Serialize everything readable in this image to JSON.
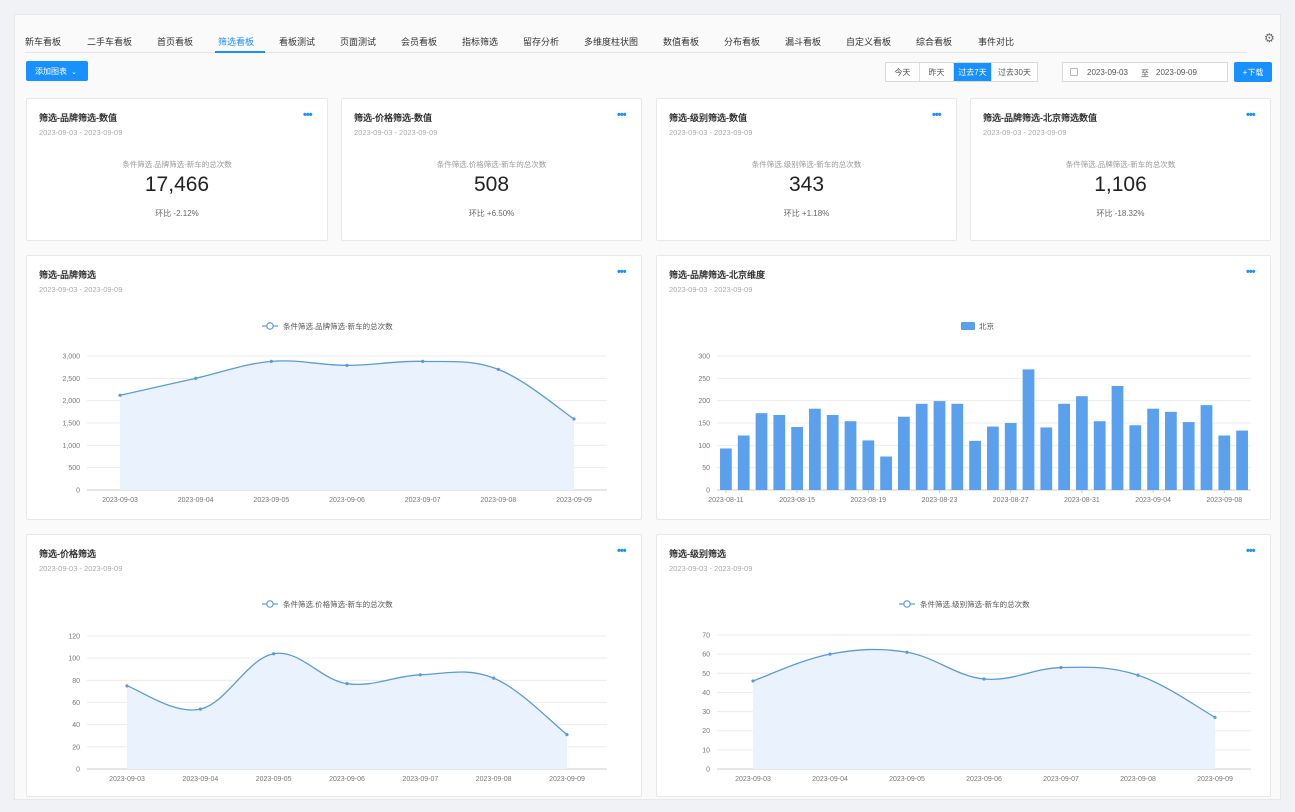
{
  "tabs": [
    "新车看板",
    "二手车看板",
    "首页看板",
    "筛选看板",
    "看板测试",
    "页面测试",
    "会员看板",
    "指标筛选",
    "留存分析",
    "多维度柱状图",
    "数值看板",
    "分布看板",
    "漏斗看板",
    "自定义看板",
    "综合看板",
    "事件对比"
  ],
  "active_tab": 3,
  "toolbar": {
    "add_label": "添加图表",
    "ranges": [
      "今天",
      "昨天",
      "过去7天",
      "过去30天"
    ],
    "active_range": 2,
    "date_start": "2023-09-03",
    "date_sep": "至",
    "date_end": "2023-09-09",
    "download_label": "+下载"
  },
  "kpis": [
    {
      "title": "筛选-品牌筛选-数值",
      "date": "2023-09-03 - 2023-09-09",
      "label": "条件筛选.品牌筛选-新车的总次数",
      "value": "17,466",
      "change": "环比 -2.12%"
    },
    {
      "title": "筛选-价格筛选-数值",
      "date": "2023-09-03 - 2023-09-09",
      "label": "条件筛选.价格筛选-新车的总次数",
      "value": "508",
      "change": "环比 +6.50%"
    },
    {
      "title": "筛选-级别筛选-数值",
      "date": "2023-09-03 - 2023-09-09",
      "label": "条件筛选.级别筛选-新车的总次数",
      "value": "343",
      "change": "环比 +1.18%"
    },
    {
      "title": "筛选-品牌筛选-北京筛选数值",
      "date": "2023-09-03 - 2023-09-09",
      "label": "条件筛选.品牌筛选-新车的总次数",
      "value": "1,106",
      "change": "环比 -18.32%"
    }
  ],
  "charts": {
    "brand": {
      "title": "筛选-品牌筛选",
      "date": "2023-09-03 - 2023-09-09"
    },
    "beijing": {
      "title": "筛选-品牌筛选-北京维度",
      "date": "2023-09-03 - 2023-09-09"
    },
    "price": {
      "title": "筛选-价格筛选",
      "date": "2023-09-03 - 2023-09-09"
    },
    "level": {
      "title": "筛选-级别筛选",
      "date": "2023-09-03 - 2023-09-09"
    }
  },
  "chart_data": [
    {
      "id": "brand",
      "type": "area",
      "categories": [
        "2023-09-03",
        "2023-09-04",
        "2023-09-05",
        "2023-09-06",
        "2023-09-07",
        "2023-09-08",
        "2023-09-09"
      ],
      "series": [
        {
          "name": "条件筛选.品牌筛选-新车的总次数",
          "values": [
            2120,
            2500,
            2880,
            2790,
            2880,
            2700,
            1590
          ]
        }
      ],
      "yticks": [
        "0",
        "500",
        "1,000",
        "1,500",
        "2,000",
        "2,500",
        "3,000"
      ],
      "ylim": [
        0,
        3000
      ],
      "grid": true,
      "legend": "top-center",
      "color": "#5b9bd5"
    },
    {
      "id": "beijing",
      "type": "bar",
      "categories": [
        "2023-08-11",
        "2023-08-12",
        "2023-08-13",
        "2023-08-14",
        "2023-08-15",
        "2023-08-16",
        "2023-08-17",
        "2023-08-18",
        "2023-08-19",
        "2023-08-20",
        "2023-08-21",
        "2023-08-22",
        "2023-08-23",
        "2023-08-24",
        "2023-08-25",
        "2023-08-26",
        "2023-08-27",
        "2023-08-28",
        "2023-08-29",
        "2023-08-30",
        "2023-08-31",
        "2023-09-01",
        "2023-09-02",
        "2023-09-03",
        "2023-09-04",
        "2023-09-05",
        "2023-09-06",
        "2023-09-07",
        "2023-09-08",
        "2023-09-09"
      ],
      "xticks": [
        "2023-08-11",
        "2023-08-15",
        "2023-08-19",
        "2023-08-23",
        "2023-08-27",
        "2023-08-31",
        "2023-09-04",
        "2023-09-08"
      ],
      "series": [
        {
          "name": "北京",
          "values": [
            93,
            122,
            172,
            168,
            141,
            182,
            168,
            154,
            111,
            75,
            164,
            193,
            199,
            193,
            110,
            142,
            150,
            270,
            140,
            193,
            210,
            154,
            233,
            145,
            182,
            175,
            152,
            190,
            122,
            133
          ]
        }
      ],
      "yticks": [
        "0",
        "50",
        "100",
        "150",
        "200",
        "250",
        "300"
      ],
      "ylim": [
        0,
        300
      ],
      "grid": true,
      "legend": "top-center",
      "color": "#5aa0ed"
    },
    {
      "id": "price",
      "type": "area",
      "categories": [
        "2023-09-03",
        "2023-09-04",
        "2023-09-05",
        "2023-09-06",
        "2023-09-07",
        "2023-09-08",
        "2023-09-09"
      ],
      "series": [
        {
          "name": "条件筛选.价格筛选-新车的总次数",
          "values": [
            75,
            54,
            104,
            77,
            85,
            82,
            31
          ]
        }
      ],
      "yticks": [
        "0",
        "20",
        "40",
        "60",
        "80",
        "100",
        "120"
      ],
      "ylim": [
        0,
        120
      ],
      "grid": true,
      "legend": "top-center",
      "color": "#5b9bd5"
    },
    {
      "id": "level",
      "type": "area",
      "categories": [
        "2023-09-03",
        "2023-09-04",
        "2023-09-05",
        "2023-09-06",
        "2023-09-07",
        "2023-09-08",
        "2023-09-09"
      ],
      "series": [
        {
          "name": "条件筛选.级别筛选-新车的总次数",
          "values": [
            46,
            60,
            61,
            47,
            53,
            49,
            27
          ]
        }
      ],
      "yticks": [
        "0",
        "10",
        "20",
        "30",
        "40",
        "50",
        "60",
        "70"
      ],
      "ylim": [
        0,
        70
      ],
      "grid": true,
      "legend": "top-center",
      "color": "#5b9bd5"
    }
  ]
}
